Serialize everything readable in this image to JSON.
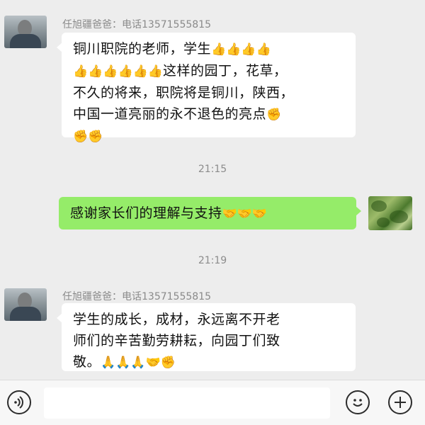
{
  "messages": [
    {
      "sender": "任旭疆爸爸：电话13571555815",
      "lines": [
        "铜川职院的老师，学生",
        "这样的园丁，花草，",
        "不久的将来，职院将是铜川，陕西，",
        "中国一道亮丽的永不退色的亮点"
      ],
      "emoji_line1": "👍👍👍👍",
      "emoji_line2_prefix": "👍👍👍👍👍👍",
      "emoji_line4_suffix": "✊",
      "emoji_line5": "✊✊"
    },
    {
      "time": "21:15"
    },
    {
      "text": "感谢家长们的理解与支持",
      "emoji": "🤝🤝🤝"
    },
    {
      "time": "21:19"
    },
    {
      "sender": "任旭疆爸爸：电话13571555815",
      "lines": [
        "学生的成长，成材，永远离不开老",
        "师们的辛苦勤劳耕耘，向园丁们致",
        "敬。"
      ],
      "emoji_line3_suffix": "🙏🙏🙏🤝✊"
    }
  ],
  "icons": {
    "voice": "voice-icon",
    "emoji": "emoji-icon",
    "plus": "plus-icon"
  },
  "colors": {
    "background": "#ededed",
    "incoming_bubble": "#ffffff",
    "outgoing_bubble": "#95ec69",
    "time_text": "#8c8c8c"
  }
}
